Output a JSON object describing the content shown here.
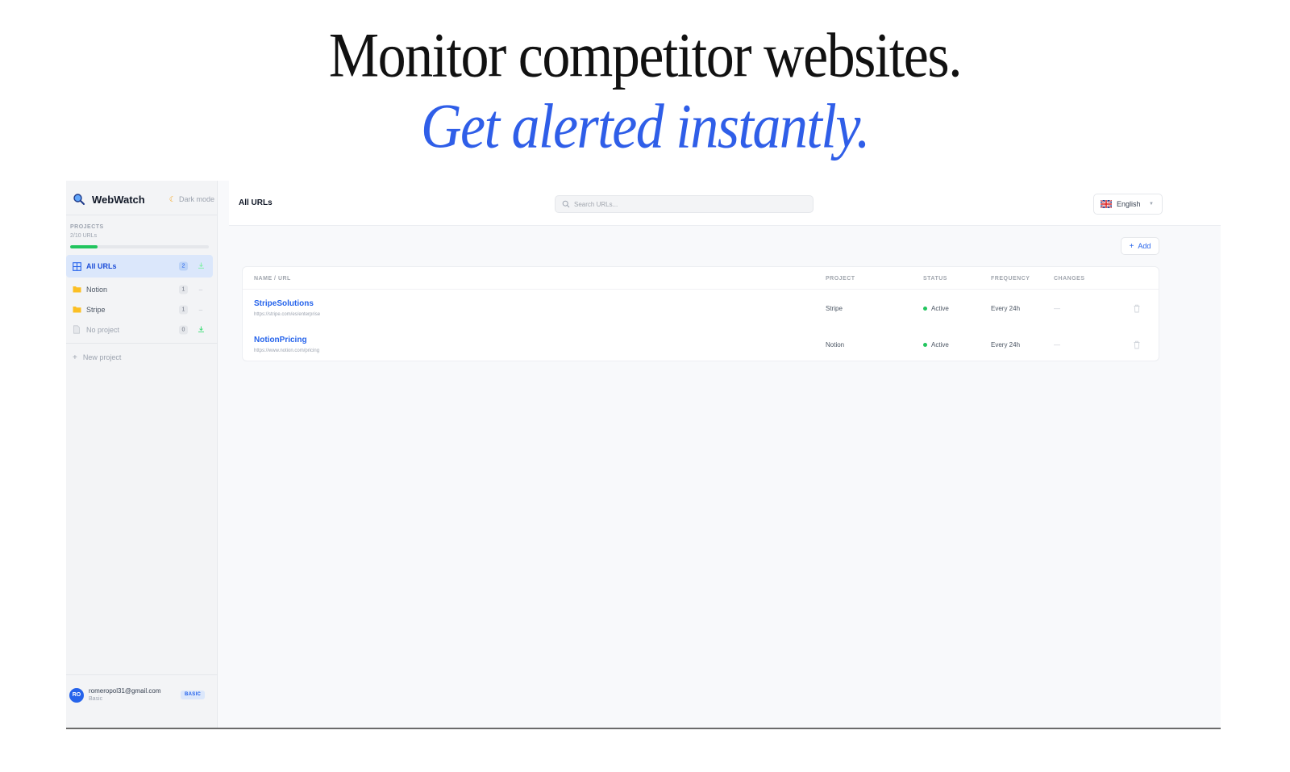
{
  "hero": {
    "line1": "Monitor competitor websites.",
    "line2": "Get alerted instantly."
  },
  "sidebar": {
    "brand": "WebWatch",
    "dark_mode_label": "Dark mode",
    "projects_label": "PROJECTS",
    "url_usage": "2/10 URLs",
    "url_usage_fraction": 0.2,
    "items": [
      {
        "label": "All URLs",
        "count": "2",
        "icon": "grid-icon",
        "active": true
      },
      {
        "label": "Notion",
        "count": "1",
        "icon": "folder-icon"
      },
      {
        "label": "Stripe",
        "count": "1",
        "icon": "folder-icon"
      },
      {
        "label": "No project",
        "count": "0",
        "icon": "document-icon"
      }
    ],
    "new_project_label": "New project",
    "user": {
      "initials": "RO",
      "email": "romeropol31@gmail.com",
      "plan": "Basic",
      "plan_badge": "BASIC"
    }
  },
  "topbar": {
    "title": "All URLs",
    "search_placeholder": "Search URLs...",
    "language": "English"
  },
  "add_button_label": "Add",
  "table": {
    "columns": [
      "NAME / URL",
      "PROJECT",
      "STATUS",
      "FREQUENCY",
      "CHANGES"
    ],
    "rows": [
      {
        "name": "StripeSolutions",
        "url": "https://stripe.com/es/enterprise",
        "project": "Stripe",
        "status": "Active",
        "frequency": "Every 24h",
        "changes": "—"
      },
      {
        "name": "NotionPricing",
        "url": "https://www.notion.com/pricing",
        "project": "Notion",
        "status": "Active",
        "frequency": "Every 24h",
        "changes": "—"
      }
    ]
  },
  "colors": {
    "accent": "#2563eb",
    "hero_accent": "#2f5ee8",
    "active_status": "#22c55e"
  }
}
